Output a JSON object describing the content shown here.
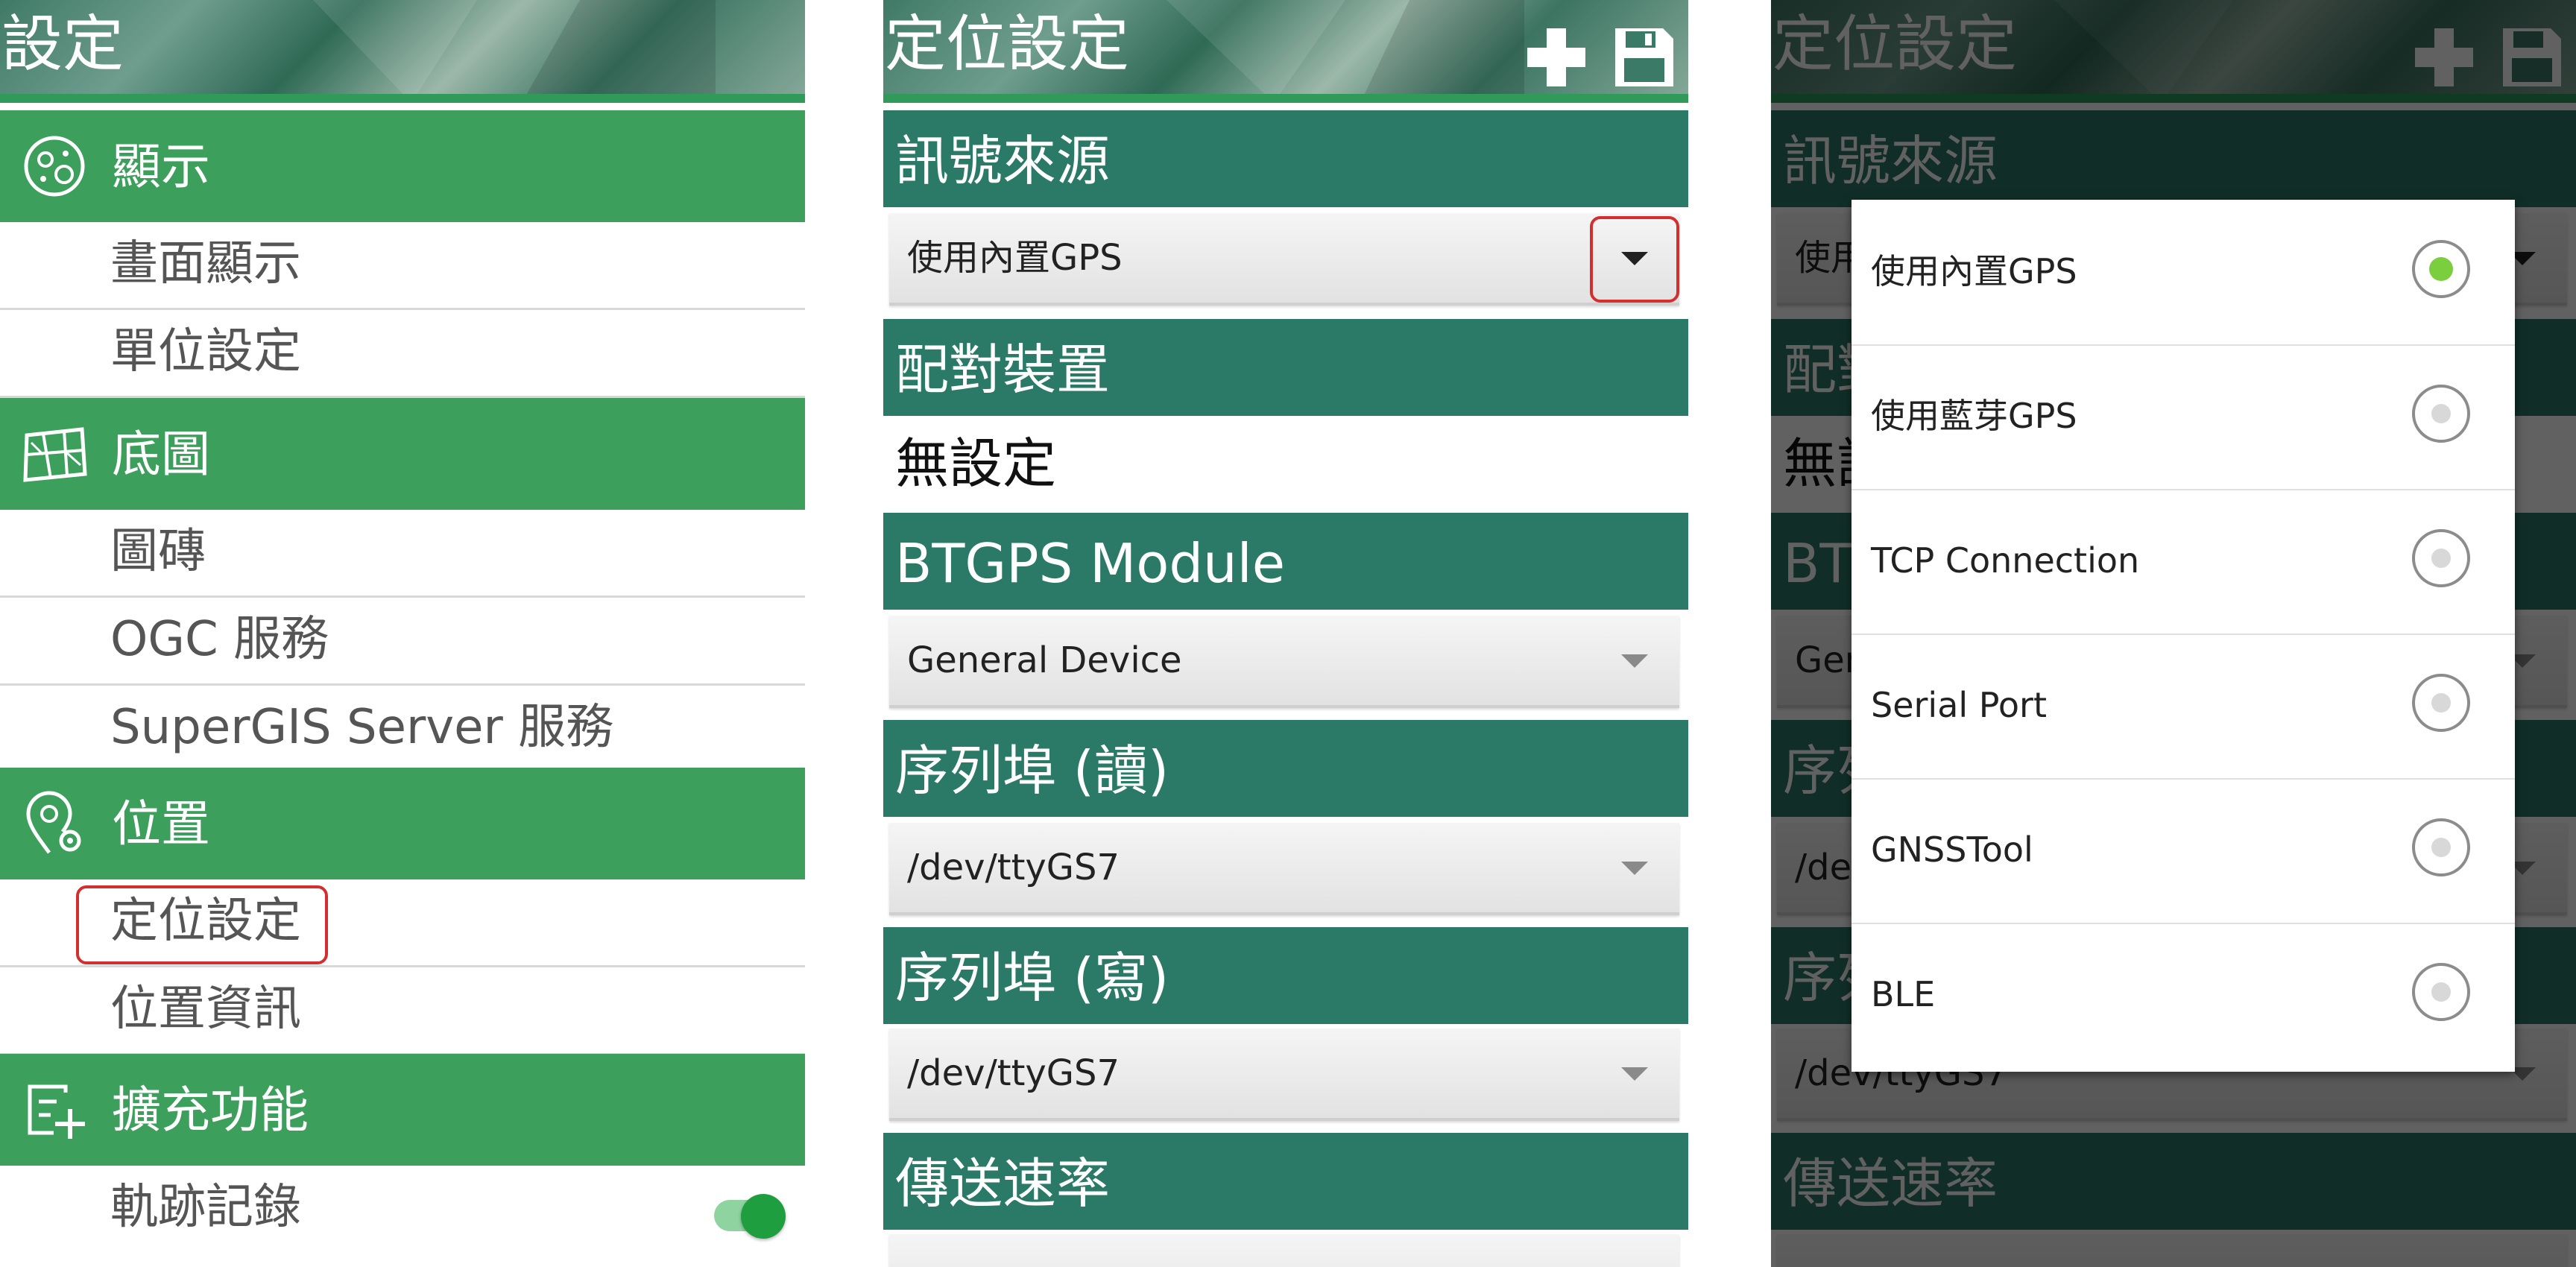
{
  "settings_panel": {
    "title": "設定",
    "categories": [
      {
        "label": "顯示",
        "icon": "display-icon",
        "items": [
          "畫面顯示",
          "單位設定"
        ]
      },
      {
        "label": "底圖",
        "icon": "map-icon",
        "items": [
          "圖磚",
          "OGC 服務",
          "SuperGIS Server 服務"
        ]
      },
      {
        "label": "位置",
        "icon": "location-gear-icon",
        "items": [
          "定位設定",
          "位置資訊"
        ]
      },
      {
        "label": "擴充功能",
        "icon": "add-extension-icon",
        "items": [
          "軌跡記錄"
        ]
      }
    ],
    "highlighted_item": "定位設定",
    "track_toggle_on": true,
    "accent_color": "#3d9f5c"
  },
  "positioning_panel": {
    "title": "定位設定",
    "toolbar": {
      "add_icon": "plus-icon",
      "save_icon": "save-icon"
    },
    "sections": {
      "signal_source": {
        "label": "訊號來源",
        "value": "使用內置GPS"
      },
      "paired_device": {
        "label": "配對裝置",
        "value": "無設定"
      },
      "btgps_module": {
        "label": "BTGPS Module",
        "value": "General Device"
      },
      "serial_read": {
        "label": "序列埠 (讀)",
        "value": "/dev/ttyGS7"
      },
      "serial_write": {
        "label": "序列埠 (寫)",
        "value": "/dev/ttyGS7"
      },
      "baud_rate": {
        "label": "傳送速率"
      }
    },
    "header_color": "#2b7a68"
  },
  "source_dialog": {
    "options": [
      "使用內置GPS",
      "使用藍芽GPS",
      "TCP Connection",
      "Serial Port",
      "GNSSTool",
      "BLE"
    ],
    "selected": "使用內置GPS",
    "selected_color": "#7bcf3f"
  }
}
